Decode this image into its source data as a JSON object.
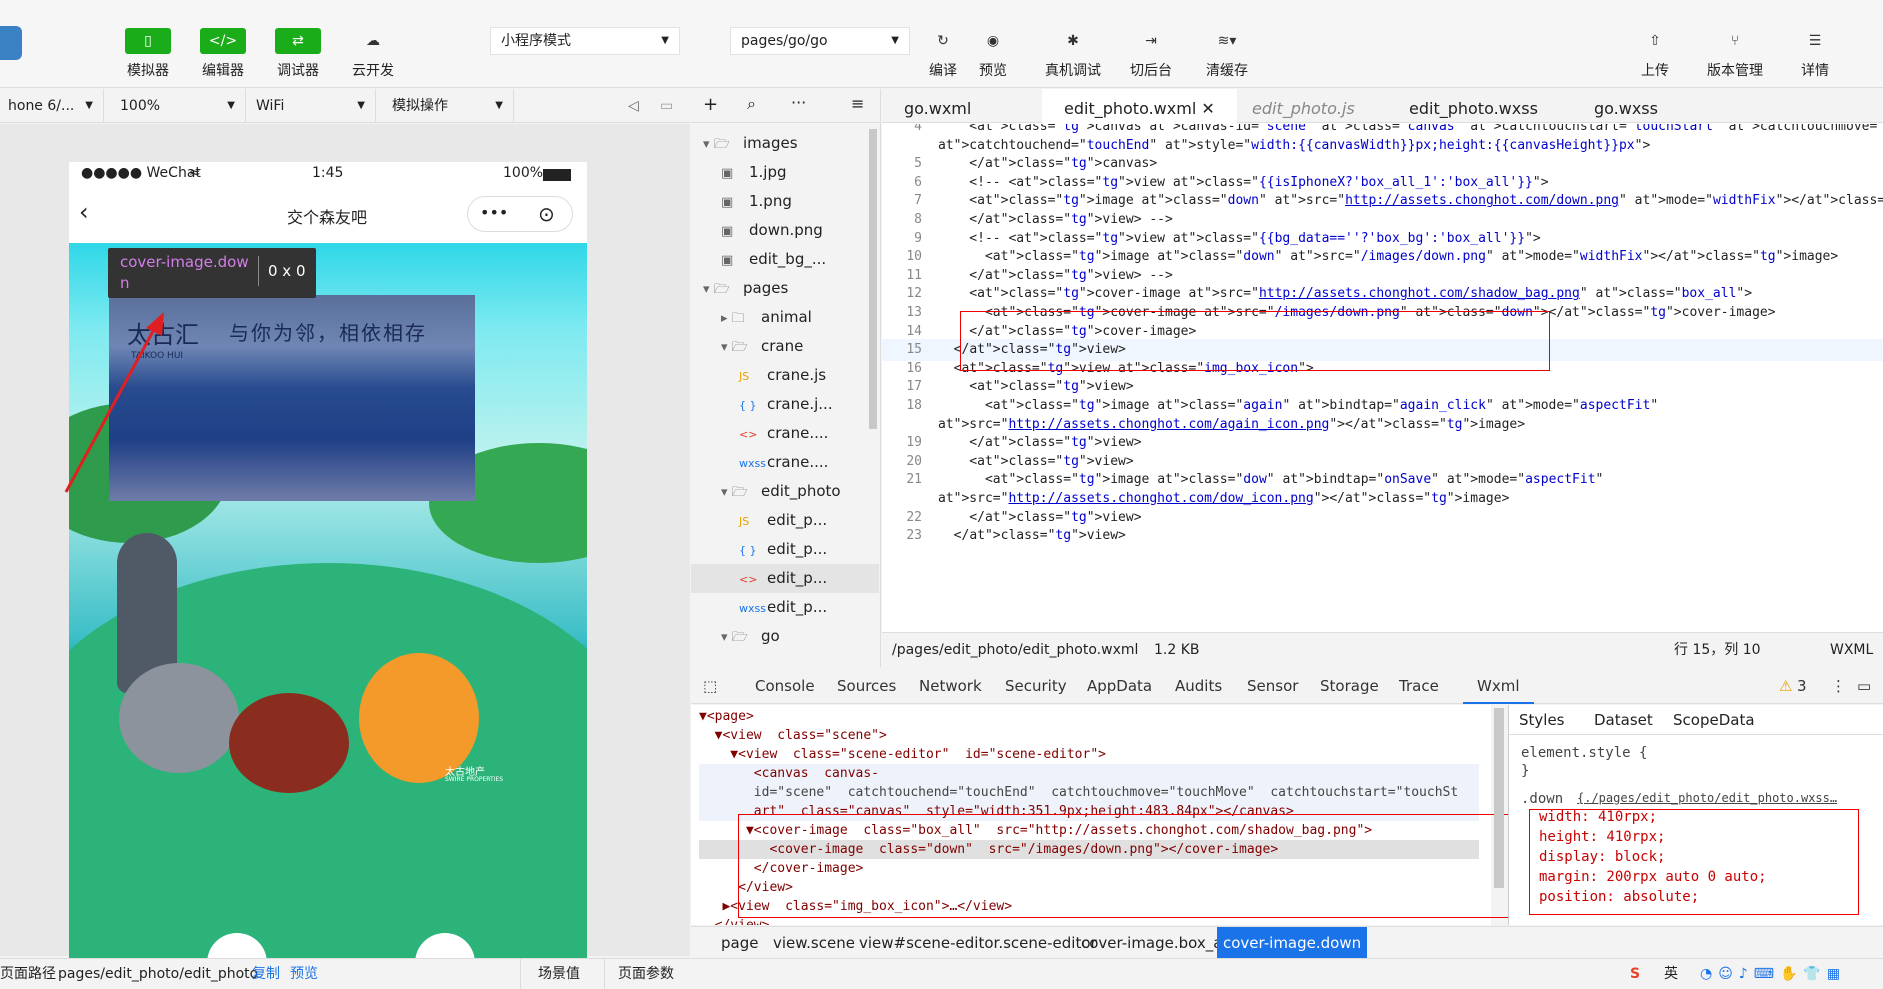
{
  "toolbar": {
    "simulator": "模拟器",
    "editor": "编辑器",
    "debugger": "调试器",
    "cloud": "云开发",
    "mode_select": "小程序模式",
    "page_select": "pages/go/go",
    "compile": "编译",
    "preview": "预览",
    "real_debug": "真机调试",
    "background": "切后台",
    "clear_cache": "清缓存",
    "upload": "上传",
    "version": "版本管理",
    "details": "详情"
  },
  "simbar": {
    "device": "hone 6/...",
    "zoom": "100%",
    "network": "WiFi",
    "operation": "模拟操作"
  },
  "phone": {
    "carrier": "●●●●● WeChat",
    "time": "1:45",
    "battery": "100%",
    "nav_title": "交个森友吧",
    "banner_text": "与你为邻，相依相存",
    "banner_logo": "太古汇",
    "banner_logo_en": "TAIKOO HUI",
    "bottom_logo": "太古地产",
    "bottom_logo_en": "SWIRE PROPERTIES"
  },
  "tooltip": {
    "name_line1": "cover-image.dow",
    "name_line2": "n",
    "size": "0 x 0"
  },
  "explorer": {
    "items": [
      {
        "label": "images",
        "type": "folder-open"
      },
      {
        "label": "1.jpg",
        "type": "image"
      },
      {
        "label": "1.png",
        "type": "image"
      },
      {
        "label": "down.png",
        "type": "image"
      },
      {
        "label": "edit_bg_...",
        "type": "image"
      },
      {
        "label": "pages",
        "type": "folder-open"
      },
      {
        "label": "animal",
        "type": "folder-closed"
      },
      {
        "label": "crane",
        "type": "folder-open"
      },
      {
        "label": "crane.js",
        "type": "js"
      },
      {
        "label": "crane.j...",
        "type": "json"
      },
      {
        "label": "crane....",
        "type": "wxml"
      },
      {
        "label": "crane....",
        "type": "wxss"
      },
      {
        "label": "edit_photo",
        "type": "folder-open"
      },
      {
        "label": "edit_p...",
        "type": "js"
      },
      {
        "label": "edit_p...",
        "type": "json"
      },
      {
        "label": "edit_p...",
        "type": "wxml"
      },
      {
        "label": "edit_p...",
        "type": "wxss"
      },
      {
        "label": "go",
        "type": "folder-open"
      }
    ]
  },
  "tabs": [
    "go.wxml",
    "edit_photo.wxml",
    "edit_photo.js",
    "edit_photo.wxss",
    "go.wxss"
  ],
  "code": {
    "lines": [
      {
        "n": "4",
        "text": "    <canvas canvas-id=\"scene\" class=\"canvas\" catchtouchstart=\"touchStart\" catchtouchmove=\"touchMove\""
      },
      {
        "n": "",
        "text": "catchtouchend=\"touchEnd\" style=\"width:{{canvasWidth}}px;height:{{canvasHeight}}px\">"
      },
      {
        "n": "5",
        "text": "    </canvas>"
      },
      {
        "n": "6",
        "text": "    <!-- <view class=\"{{isIphoneX?'box_all_1':'box_all'}}\">"
      },
      {
        "n": "7",
        "text": "    <image class=\"down\" src=\"http://assets.chonghot.com/down.png\" mode=\"widthFix\"></image>"
      },
      {
        "n": "8",
        "text": "    </view> -->"
      },
      {
        "n": "9",
        "text": "    <!-- <view class=\"{{bg_data==''?'box_bg':'box_all'}}\">"
      },
      {
        "n": "10",
        "text": "      <image class=\"down\" src=\"/images/down.png\" mode=\"widthFix\"></image>"
      },
      {
        "n": "11",
        "text": "    </view> -->"
      },
      {
        "n": "12",
        "text": "    <cover-image src=\"http://assets.chonghot.com/shadow_bag.png\" class=\"box_all\">"
      },
      {
        "n": "13",
        "text": "      <cover-image src=\"/images/down.png\" class=\"down\"></cover-image>"
      },
      {
        "n": "14",
        "text": "    </cover-image>"
      },
      {
        "n": "15",
        "text": "  </view>"
      },
      {
        "n": "16",
        "text": "  <view class=\"img_box_icon\">"
      },
      {
        "n": "17",
        "text": "    <view>"
      },
      {
        "n": "18",
        "text": "      <image class=\"again\" bindtap=\"again_click\" mode=\"aspectFit\""
      },
      {
        "n": "",
        "text": "src=\"http://assets.chonghot.com/again_icon.png\"></image>"
      },
      {
        "n": "19",
        "text": "    </view>"
      },
      {
        "n": "20",
        "text": "    <view>"
      },
      {
        "n": "21",
        "text": "      <image class=\"dow\" bindtap=\"onSave\" mode=\"aspectFit\""
      },
      {
        "n": "",
        "text": "src=\"http://assets.chonghot.com/dow_icon.png\"></image>"
      },
      {
        "n": "22",
        "text": "    </view>"
      },
      {
        "n": "23",
        "text": "  </view>"
      }
    ]
  },
  "editor_status": {
    "path": "/pages/edit_photo/edit_photo.wxml",
    "size": "1.2 KB",
    "position": "行 15，列 10",
    "lang": "WXML"
  },
  "devtools": {
    "tabs": [
      "Console",
      "Sources",
      "Network",
      "Security",
      "AppData",
      "Audits",
      "Sensor",
      "Storage",
      "Trace",
      "Wxml"
    ],
    "warnings": "3"
  },
  "wxml": {
    "lines": [
      "▼<page>",
      "  ▼<view  class=\"scene\">",
      "    ▼<view  class=\"scene-editor\"  id=\"scene-editor\">",
      "       <canvas  canvas-",
      "       id=\"scene\"  catchtouchend=\"touchEnd\"  catchtouchmove=\"touchMove\"  catchtouchstart=\"touchSt",
      "       art\"  class=\"canvas\"  style=\"width:351.9px;height:483.84px\"></canvas>",
      "      ▼<cover-image  class=\"box_all\"  src=\"http://assets.chonghot.com/shadow_bag.png\">",
      "         <cover-image  class=\"down\"  src=\"/images/down.png\"></cover-image>",
      "       </cover-image>",
      "     </view>",
      "   ▶<view  class=\"img_box_icon\">…</view>",
      "  </view>"
    ]
  },
  "styles": {
    "tabs": [
      "Styles",
      "Dataset",
      "ScopeData"
    ],
    "element_style": "element.style {",
    "close": "}",
    "selector": ".down",
    "source": "{./pages/edit_photo/edit_photo.wxss…",
    "props": [
      "width: 410rpx;",
      "height: 410rpx;",
      "display: block;",
      "margin: 200rpx auto 0 auto;",
      "position: absolute;"
    ]
  },
  "breadcrumb": [
    "page",
    "view.scene",
    "view#scene-editor.scene-editor",
    "cover-image.box_all",
    "cover-image.down"
  ],
  "bottom": {
    "path_label": "页面路径",
    "path": "pages/edit_photo/edit_photo",
    "copy": "复制",
    "preview": "预览",
    "scene": "场景值",
    "params": "页面参数",
    "ime": "英"
  }
}
